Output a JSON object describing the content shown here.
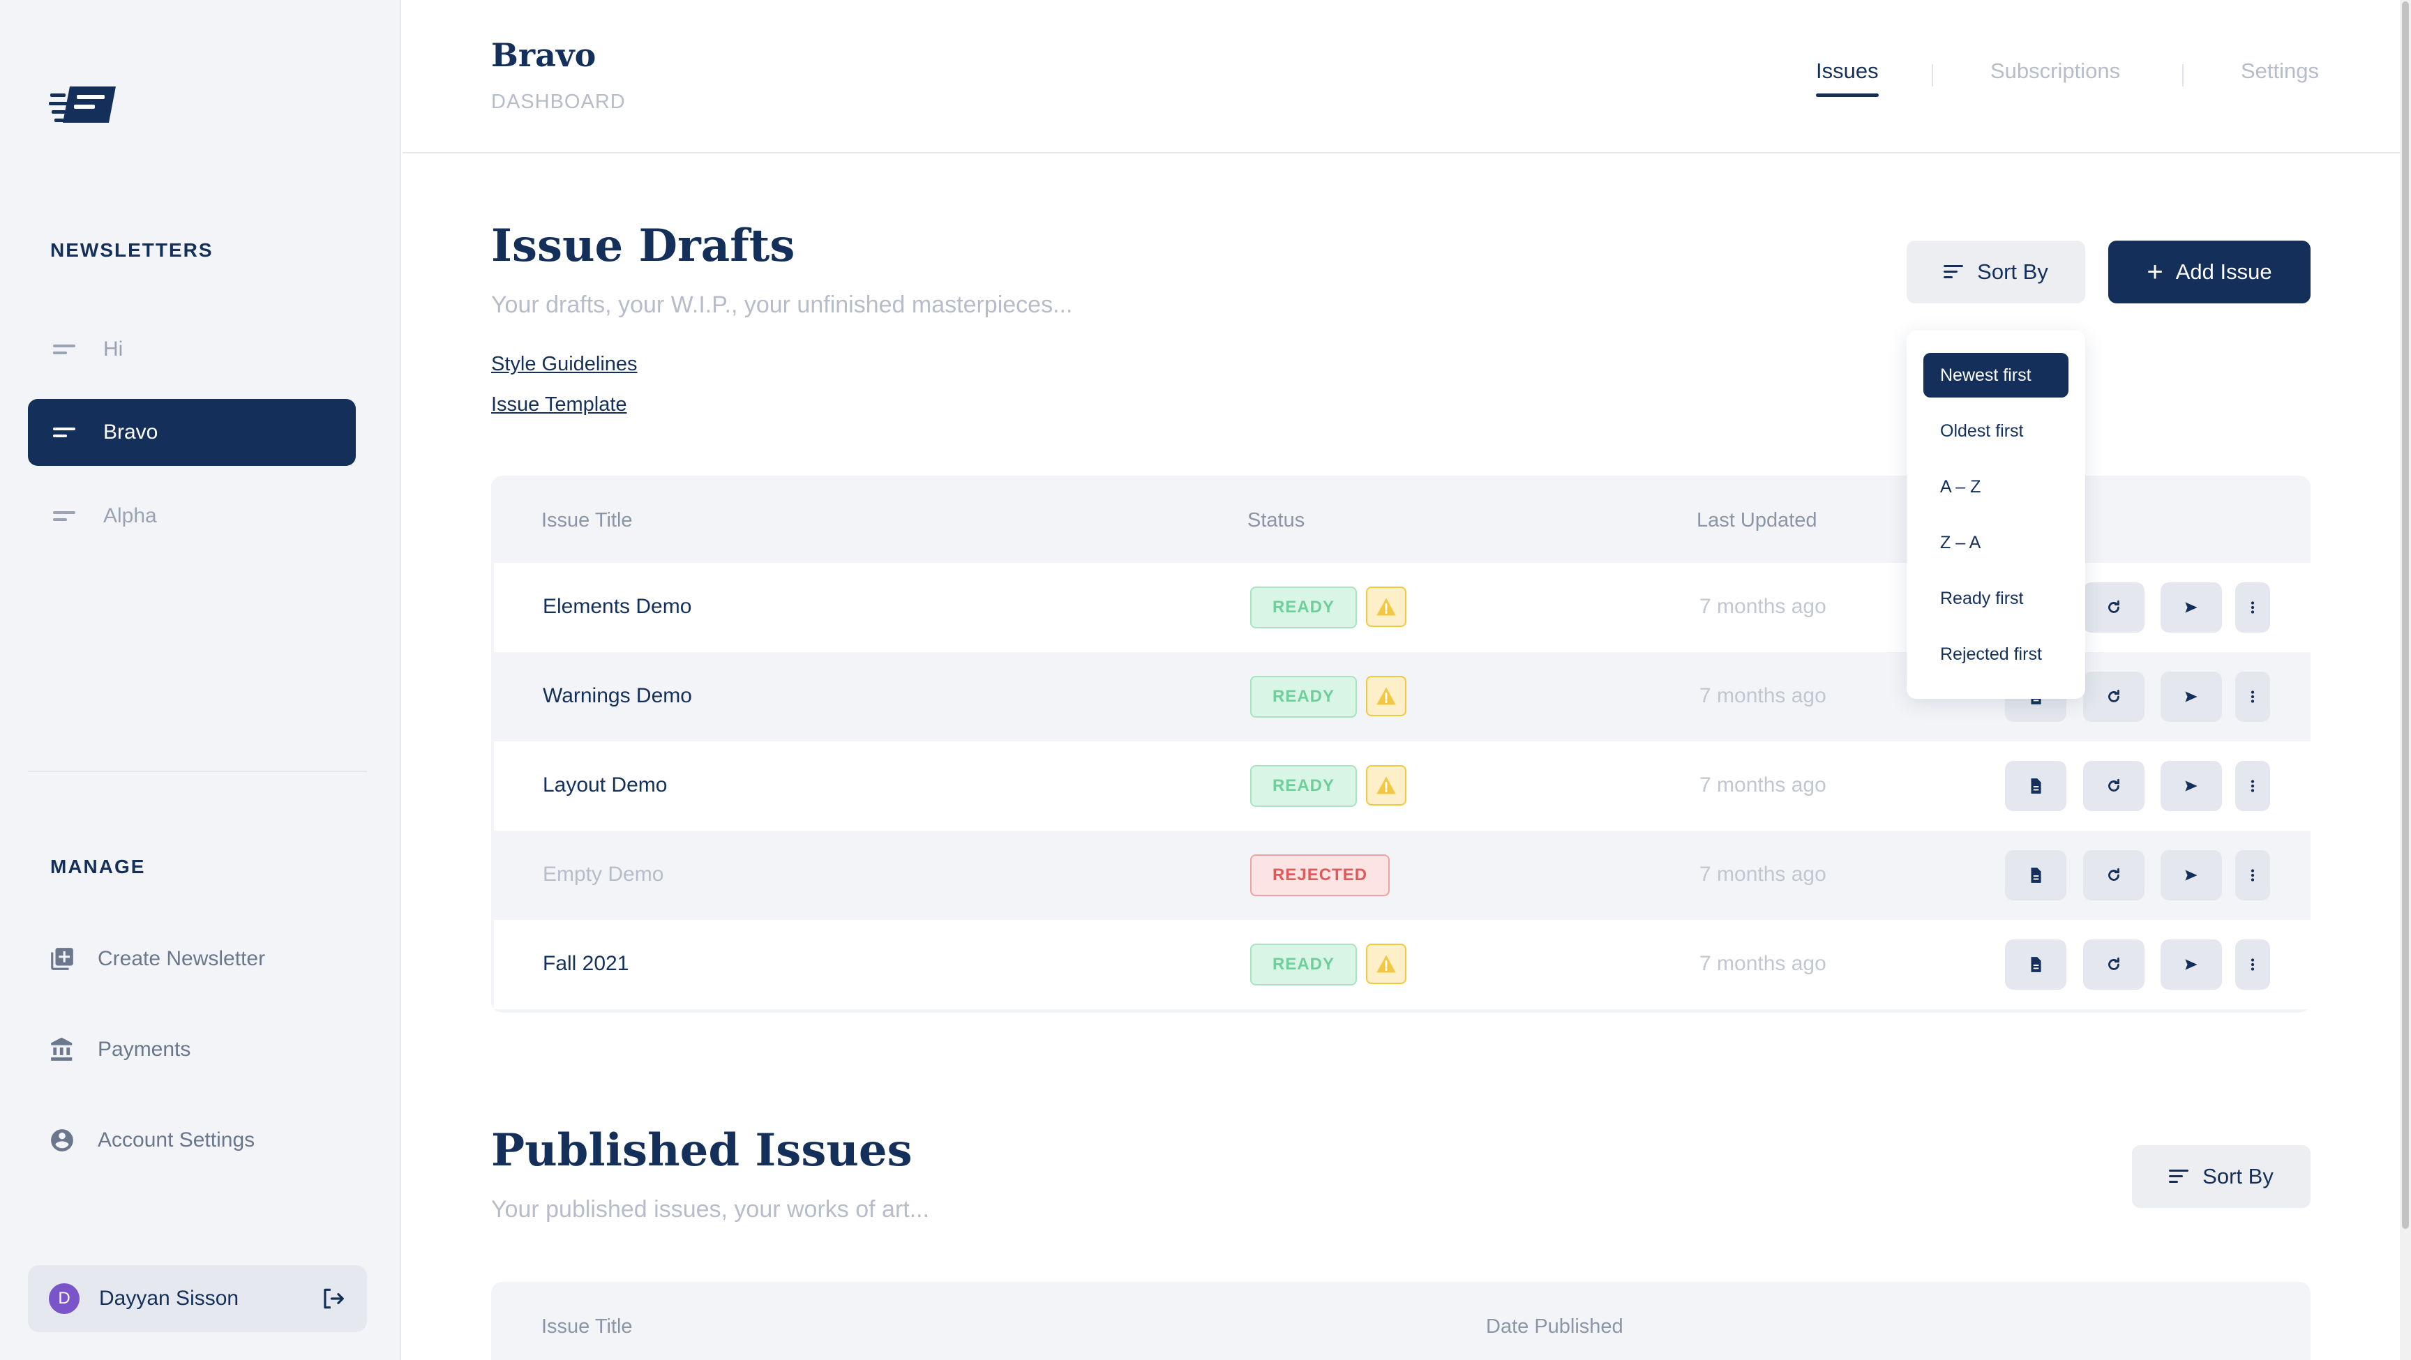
{
  "sidebar": {
    "newsletters_heading": "NEWSLETTERS",
    "newsletters": [
      {
        "label": "Hi",
        "active": false
      },
      {
        "label": "Bravo",
        "active": true
      },
      {
        "label": "Alpha",
        "active": false
      }
    ],
    "manage_heading": "MANAGE",
    "manage_items": [
      {
        "label": "Create Newsletter",
        "icon": "add-box-icon"
      },
      {
        "label": "Payments",
        "icon": "bank-icon"
      },
      {
        "label": "Account Settings",
        "icon": "account-circle-icon"
      }
    ],
    "user": {
      "initial": "D",
      "name": "Dayyan Sisson"
    }
  },
  "header": {
    "title": "Bravo",
    "subtitle": "DASHBOARD",
    "tabs": [
      {
        "label": "Issues",
        "active": true
      },
      {
        "label": "Subscriptions",
        "active": false
      },
      {
        "label": "Settings",
        "active": false
      }
    ]
  },
  "drafts": {
    "title": "Issue Drafts",
    "description": "Your drafts, your W.I.P., your unfinished masterpieces...",
    "links": [
      "Style Guidelines",
      "Issue Template"
    ],
    "sort_label": "Sort By",
    "add_label": "Add Issue",
    "columns": [
      "Issue Title",
      "Status",
      "Last Updated"
    ],
    "rows": [
      {
        "title": "Elements Demo",
        "status": "READY",
        "warning": true,
        "updated": "7 months ago"
      },
      {
        "title": "Warnings Demo",
        "status": "READY",
        "warning": true,
        "updated": "7 months ago"
      },
      {
        "title": "Layout Demo",
        "status": "READY",
        "warning": true,
        "updated": "7 months ago"
      },
      {
        "title": "Empty Demo",
        "status": "REJECTED",
        "warning": false,
        "updated": "7 months ago"
      },
      {
        "title": "Fall 2021",
        "status": "READY",
        "warning": true,
        "updated": "7 months ago"
      }
    ]
  },
  "sort_menu": {
    "options": [
      "Newest first",
      "Oldest first",
      "A – Z",
      "Z – A",
      "Ready first",
      "Rejected first"
    ],
    "selected": "Newest first"
  },
  "published": {
    "title": "Published Issues",
    "description": "Your published issues, your works of art...",
    "sort_label": "Sort By",
    "columns": [
      "Issue Title",
      "Date Published"
    ]
  },
  "colors": {
    "brand": "#14305a",
    "ready": "#6fcf9a",
    "rejected": "#e05a5a",
    "warning": "#f2c744",
    "avatar": "#7a55c9"
  }
}
